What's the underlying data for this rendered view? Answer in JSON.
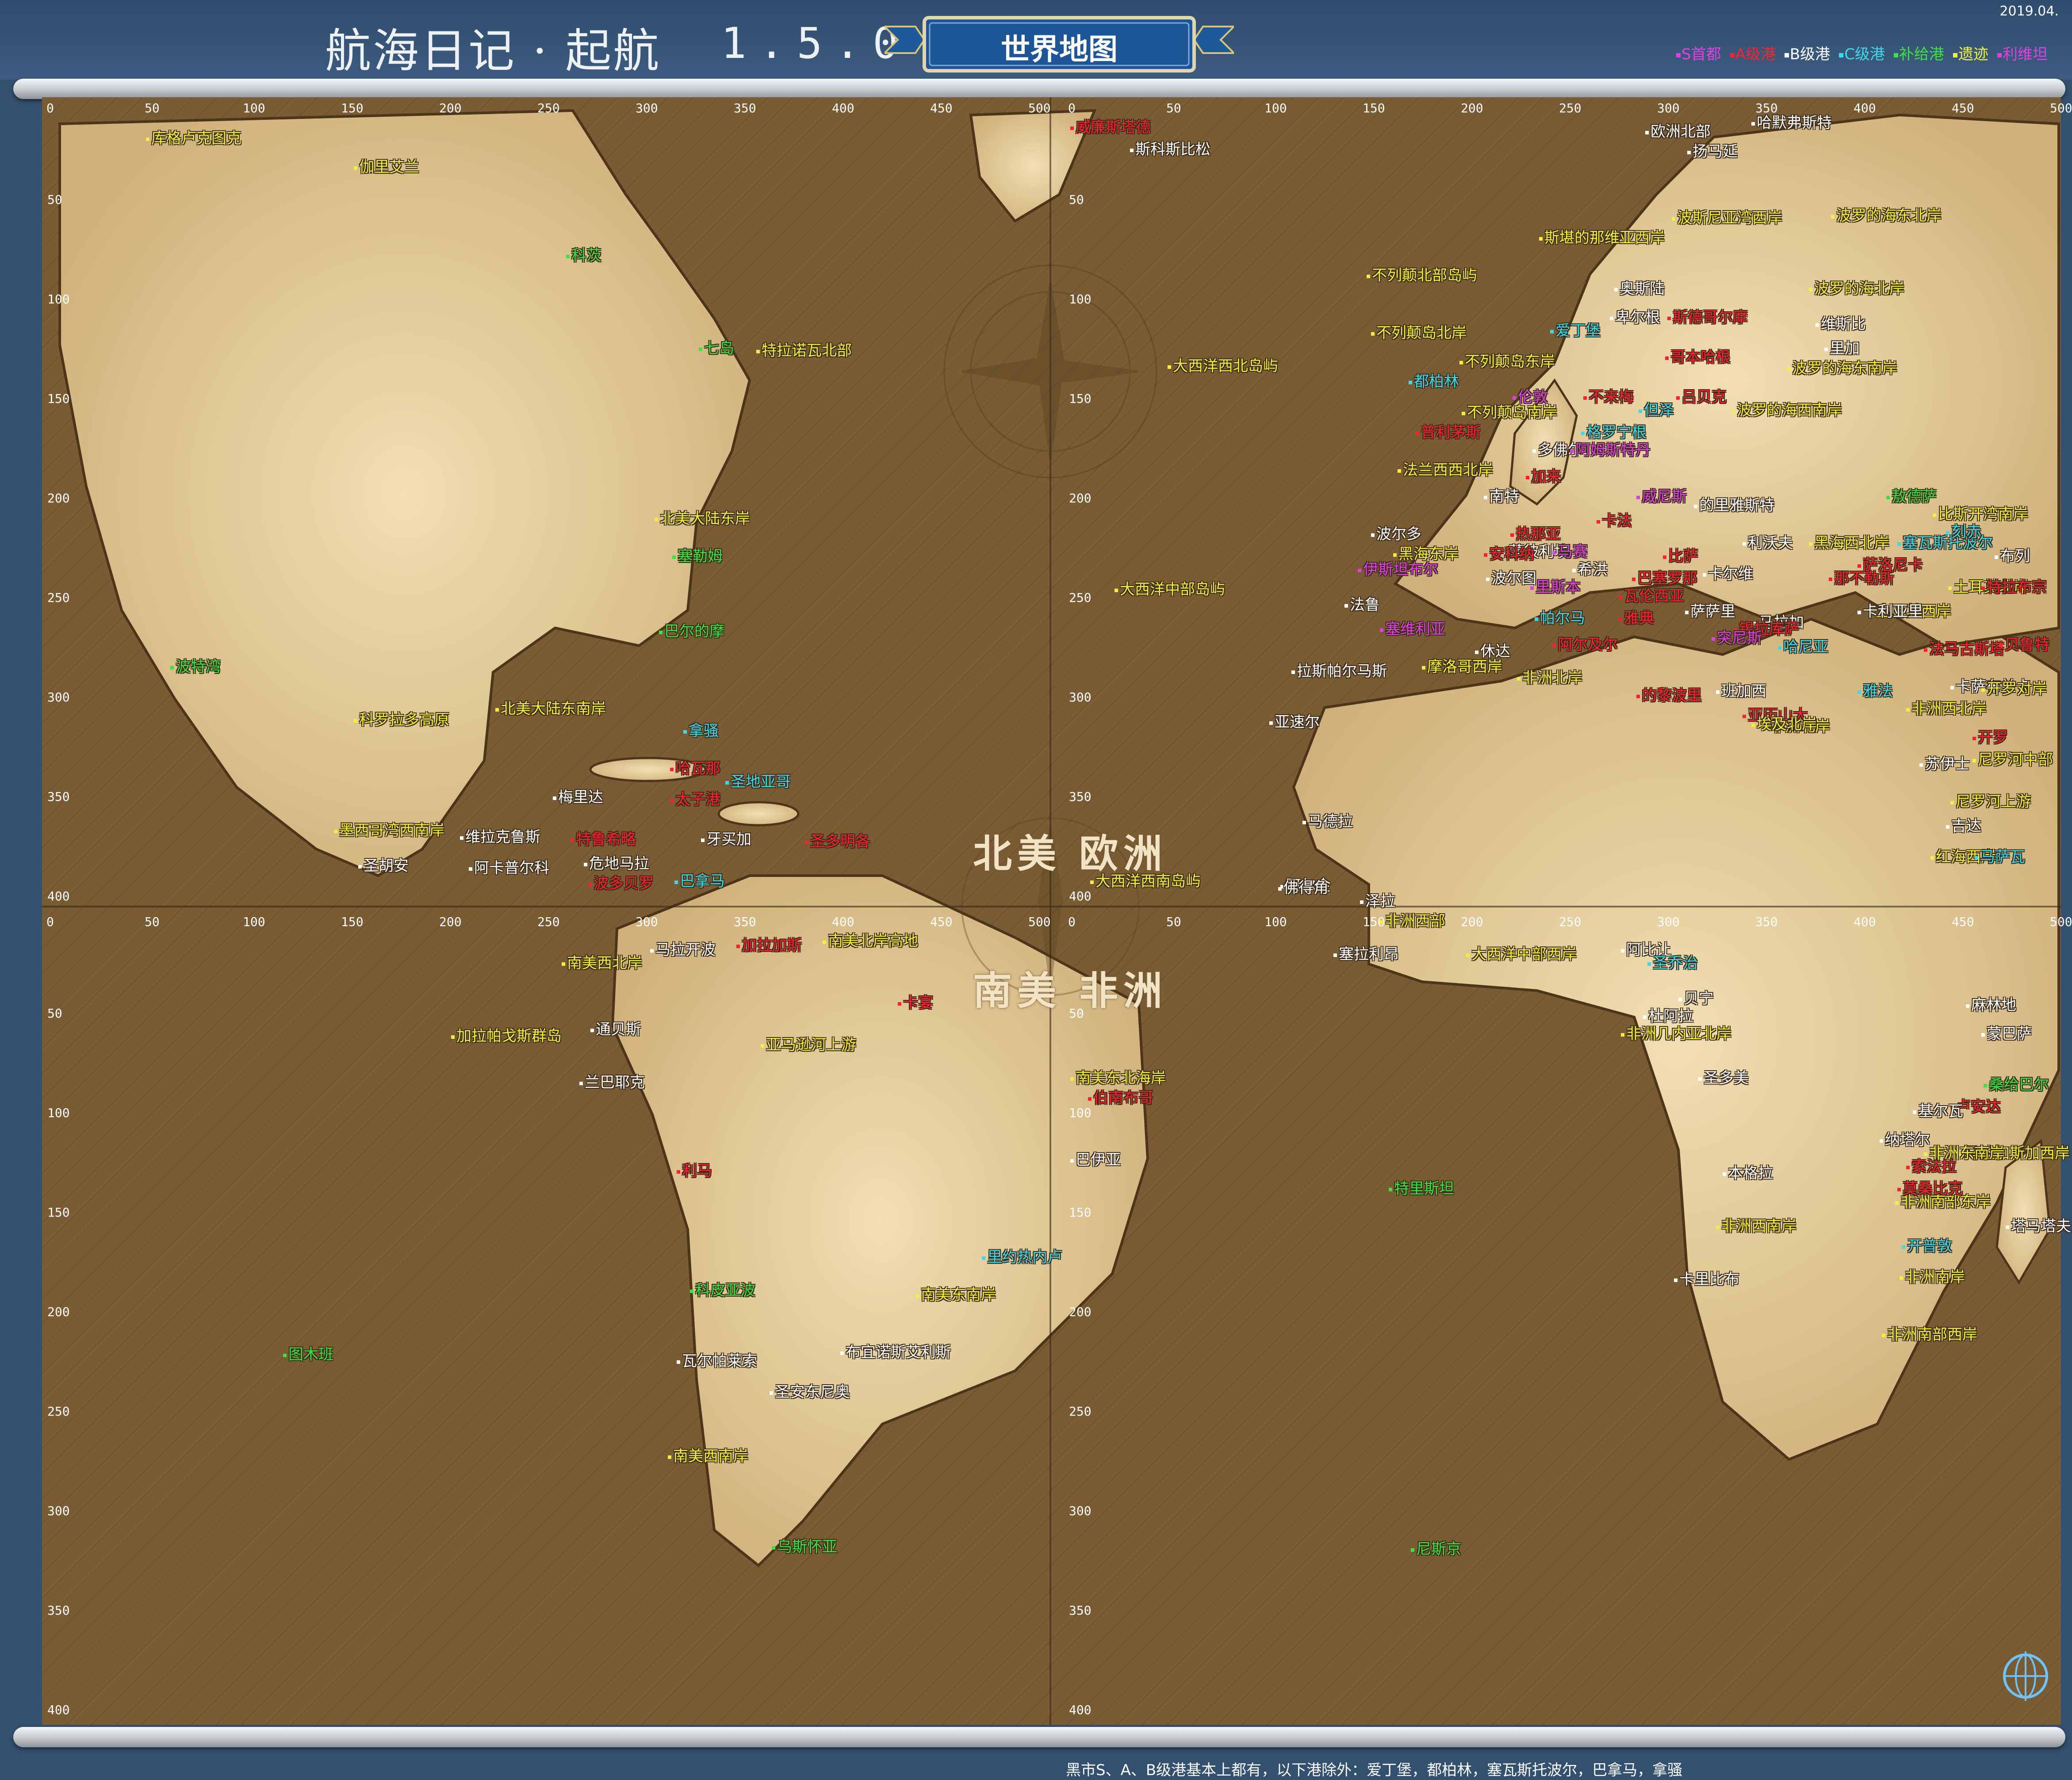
{
  "header": {
    "title": "航海日记 · 起航",
    "version": "1.5.0",
    "banner": "世界地图",
    "date": "2019.04."
  },
  "legend": [
    {
      "key": "s",
      "label": "S首都",
      "color": "#e040e0"
    },
    {
      "key": "a",
      "label": "A级港",
      "color": "#ff2030"
    },
    {
      "key": "b",
      "label": "B级港",
      "color": "#ffffff"
    },
    {
      "key": "c",
      "label": "C级港",
      "color": "#40d8e8"
    },
    {
      "key": "supply",
      "label": "补给港",
      "color": "#40e040"
    },
    {
      "key": "ruins",
      "label": "遗迹",
      "color": "#f0f040"
    },
    {
      "key": "misc",
      "label": "利维坦",
      "color": "#e040e0"
    }
  ],
  "footer_note": "黑市S、A、B级港基本上都有，以下港除外：爱丁堡，都柏林，塞瓦斯托波尔，巴拿马，拿骚",
  "regions": [
    "北美",
    "欧洲",
    "南美",
    "非洲"
  ],
  "axis": {
    "x_ticks": [
      "0",
      "50",
      "100",
      "150",
      "200",
      "250",
      "300",
      "350",
      "400",
      "450",
      "500"
    ],
    "y_ticks": [
      "0",
      "50",
      "100",
      "150",
      "200",
      "250",
      "300",
      "350",
      "400"
    ]
  },
  "colors": {
    "parchment_light": "#e9d3a1",
    "parchment_dark": "#a4834e",
    "sea": "#7a5c34",
    "frame": "#33506e"
  },
  "labels": [
    {
      "t": "库格卢克图克",
      "c": "ruins"
    },
    {
      "t": "伽里艾兰",
      "c": "ruins"
    },
    {
      "t": "科茨",
      "c": "supply"
    },
    {
      "t": "七岛",
      "c": "supply"
    },
    {
      "t": "特拉诺瓦北部",
      "c": "ruins"
    },
    {
      "t": "北美大陆东岸",
      "c": "ruins"
    },
    {
      "t": "塞勒姆",
      "c": "supply"
    },
    {
      "t": "巴尔的摩",
      "c": "supply"
    },
    {
      "t": "波特湾",
      "c": "supply"
    },
    {
      "t": "科罗拉多高原",
      "c": "ruins"
    },
    {
      "t": "北美大陆东南岸",
      "c": "ruins"
    },
    {
      "t": "拿骚",
      "c": "c"
    },
    {
      "t": "哈瓦那",
      "c": "a"
    },
    {
      "t": "圣地亚哥",
      "c": "c"
    },
    {
      "t": "太子港",
      "c": "a"
    },
    {
      "t": "梅里达",
      "c": "b"
    },
    {
      "t": "墨西哥湾西南岸",
      "c": "ruins"
    },
    {
      "t": "维拉克鲁斯",
      "c": "b"
    },
    {
      "t": "特鲁希略",
      "c": "a"
    },
    {
      "t": "牙买加",
      "c": "b"
    },
    {
      "t": "圣多明各",
      "c": "a"
    },
    {
      "t": "圣胡安",
      "c": "b"
    },
    {
      "t": "阿卡普尔科",
      "c": "b"
    },
    {
      "t": "危地马拉",
      "c": "b"
    },
    {
      "t": "波多贝罗",
      "c": "a"
    },
    {
      "t": "巴拿马",
      "c": "c"
    },
    {
      "t": "威廉斯塔德",
      "c": "a"
    },
    {
      "t": "斯科斯比松",
      "c": "b"
    },
    {
      "t": "大西洋西北岛屿",
      "c": "ruins"
    },
    {
      "t": "大西洋中部岛屿",
      "c": "ruins"
    },
    {
      "t": "亚速尔",
      "c": "b"
    },
    {
      "t": "拉斯帕尔马斯",
      "c": "b"
    },
    {
      "t": "马德拉",
      "c": "b"
    },
    {
      "t": "阿尔金",
      "c": "b"
    },
    {
      "t": "大西洋西南岛屿",
      "c": "ruins"
    },
    {
      "t": "佛得角",
      "c": "b"
    },
    {
      "t": "欧洲北部",
      "c": "b"
    },
    {
      "t": "哈默弗斯特",
      "c": "b"
    },
    {
      "t": "扬马延",
      "c": "b"
    },
    {
      "t": "波斯尼亚湾西岸",
      "c": "ruins"
    },
    {
      "t": "波罗的海东北岸",
      "c": "ruins"
    },
    {
      "t": "斯堪的那维亚西岸",
      "c": "ruins"
    },
    {
      "t": "不列颠北部岛屿",
      "c": "ruins"
    },
    {
      "t": "奥斯陆",
      "c": "b"
    },
    {
      "t": "波罗的海北岸",
      "c": "ruins"
    },
    {
      "t": "卑尔根",
      "c": "b"
    },
    {
      "t": "斯德哥尔摩",
      "c": "a"
    },
    {
      "t": "维斯比",
      "c": "b"
    },
    {
      "t": "不列颠岛北岸",
      "c": "ruins"
    },
    {
      "t": "爱丁堡",
      "c": "c"
    },
    {
      "t": "里加",
      "c": "b"
    },
    {
      "t": "哥本哈根",
      "c": "a"
    },
    {
      "t": "不列颠岛东岸",
      "c": "ruins"
    },
    {
      "t": "波罗的海东南岸",
      "c": "ruins"
    },
    {
      "t": "都柏林",
      "c": "c"
    },
    {
      "t": "伦敦",
      "c": "s"
    },
    {
      "t": "不来梅",
      "c": "a"
    },
    {
      "t": "吕贝克",
      "c": "a"
    },
    {
      "t": "但泽",
      "c": "c"
    },
    {
      "t": "波罗的海西南岸",
      "c": "ruins"
    },
    {
      "t": "不列颠岛南岸",
      "c": "ruins"
    },
    {
      "t": "普利茅斯",
      "c": "a"
    },
    {
      "t": "格罗宁根",
      "c": "c"
    },
    {
      "t": "多佛尔",
      "c": "b"
    },
    {
      "t": "阿姆斯特丹",
      "c": "s"
    },
    {
      "t": "法兰西西北岸",
      "c": "ruins"
    },
    {
      "t": "加来",
      "c": "a"
    },
    {
      "t": "南特",
      "c": "b"
    },
    {
      "t": "威尼斯",
      "c": "s"
    },
    {
      "t": "的里雅斯特",
      "c": "b"
    },
    {
      "t": "敖德萨",
      "c": "supply"
    },
    {
      "t": "利沃夫",
      "c": "b"
    },
    {
      "t": "比斯开湾南岸",
      "c": "ruins"
    },
    {
      "t": "波尔多",
      "c": "b"
    },
    {
      "t": "热那亚",
      "c": "a"
    },
    {
      "t": "卡法",
      "c": "a"
    },
    {
      "t": "蒙彼利埃",
      "c": "b"
    },
    {
      "t": "马赛",
      "c": "s"
    },
    {
      "t": "比萨",
      "c": "a"
    },
    {
      "t": "黑海西北岸",
      "c": "ruins"
    },
    {
      "t": "塞瓦斯托波尔",
      "c": "c"
    },
    {
      "t": "刻赤",
      "c": "c"
    },
    {
      "t": "布列",
      "c": "b"
    },
    {
      "t": "安科纳",
      "c": "a"
    },
    {
      "t": "伊斯坦布尔",
      "c": "s"
    },
    {
      "t": "黑海东岸",
      "c": "ruins"
    },
    {
      "t": "波尔图",
      "c": "b"
    },
    {
      "t": "希洪",
      "c": "b"
    },
    {
      "t": "巴塞罗那",
      "c": "a"
    },
    {
      "t": "卡尔维",
      "c": "b"
    },
    {
      "t": "那不勒斯",
      "c": "a"
    },
    {
      "t": "萨洛尼卡",
      "c": "a"
    },
    {
      "t": "土耳其北岸",
      "c": "ruins"
    },
    {
      "t": "特拉布宗",
      "c": "a"
    },
    {
      "t": "里斯本",
      "c": "s"
    },
    {
      "t": "瓦伦西亚",
      "c": "a"
    },
    {
      "t": "萨萨里",
      "c": "b"
    },
    {
      "t": "土耳其西岸",
      "c": "ruins"
    },
    {
      "t": "法鲁",
      "c": "b"
    },
    {
      "t": "塞维利亚",
      "c": "s"
    },
    {
      "t": "卡利亚里",
      "c": "b"
    },
    {
      "t": "帕尔马",
      "c": "c"
    },
    {
      "t": "雅典",
      "c": "a"
    },
    {
      "t": "马拉加",
      "c": "b"
    },
    {
      "t": "锡拉库萨",
      "c": "a"
    },
    {
      "t": "哈尼亚",
      "c": "c"
    },
    {
      "t": "法马古斯塔",
      "c": "a"
    },
    {
      "t": "贝鲁特",
      "c": "a"
    },
    {
      "t": "休达",
      "c": "b"
    },
    {
      "t": "阿尔及尔",
      "c": "a"
    },
    {
      "t": "突尼斯",
      "c": "s"
    },
    {
      "t": "摩洛哥西岸",
      "c": "ruins"
    },
    {
      "t": "非洲北岸",
      "c": "ruins"
    },
    {
      "t": "班加西",
      "c": "b"
    },
    {
      "t": "雅法",
      "c": "c"
    },
    {
      "t": "卡萨布兰卡",
      "c": "b"
    },
    {
      "t": "的黎波里",
      "c": "a"
    },
    {
      "t": "亚历山大",
      "c": "a"
    },
    {
      "t": "非洲西北岸",
      "c": "ruins"
    },
    {
      "t": "非洲北岸",
      "c": "ruins"
    },
    {
      "t": "埃及北岸",
      "c": "ruins"
    },
    {
      "t": "开罗",
      "c": "a"
    },
    {
      "t": "开罗对岸",
      "c": "ruins"
    },
    {
      "t": "苏伊士",
      "c": "b"
    },
    {
      "t": "尼罗河中部",
      "c": "ruins"
    },
    {
      "t": "尼罗河上游",
      "c": "ruins"
    },
    {
      "t": "吉达",
      "c": "b"
    },
    {
      "t": "红海西岸",
      "c": "ruins"
    },
    {
      "t": "马萨瓦",
      "c": "c"
    },
    {
      "t": "泽拉",
      "c": "b"
    },
    {
      "t": "非洲西部",
      "c": "ruins"
    },
    {
      "t": "塞拉利昂",
      "c": "b"
    },
    {
      "t": "大西洋中部西岸",
      "c": "ruins"
    },
    {
      "t": "阿比让",
      "c": "b"
    },
    {
      "t": "圣乔治",
      "c": "c"
    },
    {
      "t": "贝宁",
      "c": "b"
    },
    {
      "t": "非洲几内亚北岸",
      "c": "ruins"
    },
    {
      "t": "杜阿拉",
      "c": "b"
    },
    {
      "t": "圣多美",
      "c": "b"
    },
    {
      "t": "卢安达",
      "c": "a"
    },
    {
      "t": "本格拉",
      "c": "b"
    },
    {
      "t": "非洲西南岸",
      "c": "ruins"
    },
    {
      "t": "卡里比布",
      "c": "b"
    },
    {
      "t": "非洲南部西岸",
      "c": "ruins"
    },
    {
      "t": "开普敦",
      "c": "c"
    },
    {
      "t": "非洲南岸",
      "c": "ruins"
    },
    {
      "t": "非洲南部东岸",
      "c": "ruins"
    },
    {
      "t": "纳塔尔",
      "c": "b"
    },
    {
      "t": "索法拉",
      "c": "a"
    },
    {
      "t": "马达加斯加西岸",
      "c": "ruins"
    },
    {
      "t": "塔马塔夫",
      "c": "b"
    },
    {
      "t": "莫桑比克",
      "c": "a"
    },
    {
      "t": "非洲东南岸",
      "c": "ruins"
    },
    {
      "t": "基尔瓦",
      "c": "b"
    },
    {
      "t": "桑给巴尔",
      "c": "supply"
    },
    {
      "t": "蒙巴萨",
      "c": "b"
    },
    {
      "t": "麻林地",
      "c": "b"
    },
    {
      "t": "南美西北岸",
      "c": "ruins"
    },
    {
      "t": "马拉开波",
      "c": "b"
    },
    {
      "t": "加拉加斯",
      "c": "a"
    },
    {
      "t": "南美北岸高地",
      "c": "ruins"
    },
    {
      "t": "卡宴",
      "c": "a"
    },
    {
      "t": "加拉帕戈斯群岛",
      "c": "ruins"
    },
    {
      "t": "通贝斯",
      "c": "b"
    },
    {
      "t": "亚马逊河上游",
      "c": "ruins"
    },
    {
      "t": "南美东北海岸",
      "c": "ruins"
    },
    {
      "t": "伯南布哥",
      "c": "a"
    },
    {
      "t": "兰巴耶克",
      "c": "b"
    },
    {
      "t": "巴伊亚",
      "c": "b"
    },
    {
      "t": "利马",
      "c": "a"
    },
    {
      "t": "特里斯坦",
      "c": "supply"
    },
    {
      "t": "里约热内卢",
      "c": "c"
    },
    {
      "t": "科皮亚波",
      "c": "supply"
    },
    {
      "t": "南美东南岸",
      "c": "ruins"
    },
    {
      "t": "瓦尔帕莱索",
      "c": "b"
    },
    {
      "t": "布宜诺斯艾利斯",
      "c": "b"
    },
    {
      "t": "圣安东尼奥",
      "c": "b"
    },
    {
      "t": "南美西南岸",
      "c": "ruins"
    },
    {
      "t": "乌斯怀亚",
      "c": "supply"
    },
    {
      "t": "图木班",
      "c": "supply"
    },
    {
      "t": "尼斯京",
      "c": "supply"
    }
  ]
}
